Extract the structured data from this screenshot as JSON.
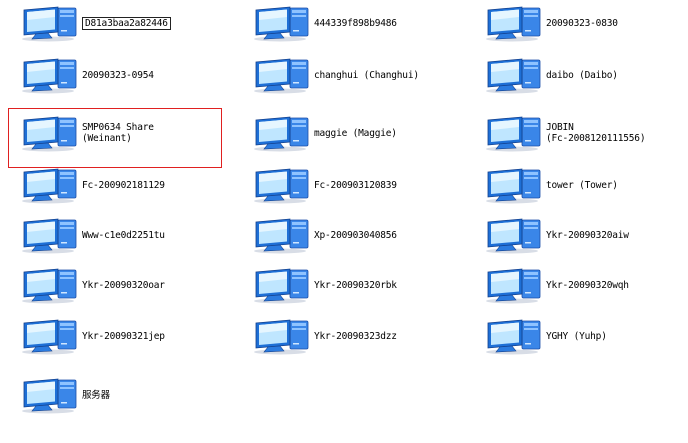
{
  "computers": [
    {
      "label": "D81a3baa2a82446",
      "boxed": true
    },
    {
      "label": "444339f898b9486"
    },
    {
      "label": "20090323-0830"
    },
    {
      "label": "20090323-0954"
    },
    {
      "label": "changhui (Changhui)"
    },
    {
      "label": "daibo (Daibo)"
    },
    {
      "label": "SMP0634 Share\n(Weinant)",
      "highlighted": true
    },
    {
      "label": "maggie (Maggie)"
    },
    {
      "label": "JOBIN\n(Fc-2008120111556)"
    },
    {
      "label": "Fc-200902181129"
    },
    {
      "label": "Fc-200903120839"
    },
    {
      "label": "tower (Tower)"
    },
    {
      "label": "Www-c1e0d2251tu"
    },
    {
      "label": "Xp-200903040856"
    },
    {
      "label": "Ykr-20090320aiw"
    },
    {
      "label": "Ykr-20090320oar"
    },
    {
      "label": "Ykr-20090320rbk"
    },
    {
      "label": "Ykr-20090320wqh"
    },
    {
      "label": "Ykr-20090321jep"
    },
    {
      "label": "Ykr-20090323dzz"
    },
    {
      "label": "YGHY (Yuhp)"
    },
    {
      "label": "服务器"
    }
  ],
  "icon": "network-computer-icon",
  "colors": {
    "highlight": "#e02020",
    "monitor_frame": "#1e6fd6",
    "screen": "#bfe6ff",
    "tower": "#3a86e8"
  }
}
